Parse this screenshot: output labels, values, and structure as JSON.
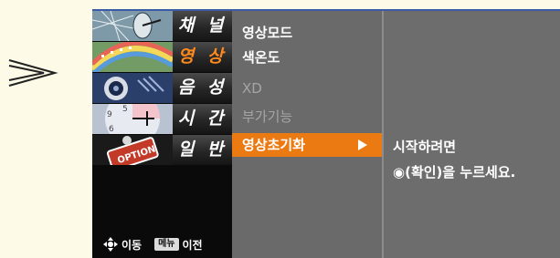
{
  "categories": [
    {
      "id": "channel",
      "label": "채 널",
      "icon": "satellite-dish-icon",
      "active": false
    },
    {
      "id": "picture",
      "label": "영 상",
      "icon": "rainbow-film-icon",
      "active": true
    },
    {
      "id": "audio",
      "label": "음 성",
      "icon": "speaker-icon",
      "active": false
    },
    {
      "id": "time",
      "label": "시 간",
      "icon": "clock-icon",
      "active": false
    },
    {
      "id": "general",
      "label": "일 반",
      "icon": "option-button-icon",
      "active": false
    }
  ],
  "submenu": [
    {
      "label": "영상모드",
      "state": "normal"
    },
    {
      "label": "색온도",
      "state": "normal"
    },
    {
      "label": "XD",
      "state": "disabled"
    },
    {
      "label": "부가기능",
      "state": "disabled"
    },
    {
      "label": "영상초기화",
      "state": "selected"
    }
  ],
  "detail": {
    "line1": "시작하려면",
    "line2": "◉(확인)을 누르세요."
  },
  "nav_hint": {
    "move_label": "이동",
    "menu_badge": "메뉴",
    "back_label": "이전"
  },
  "colors": {
    "accent": "#ec7a12",
    "active_label": "#ff8a1c",
    "panel": "#6d6d6d",
    "top_border": "#3b5aa8"
  }
}
